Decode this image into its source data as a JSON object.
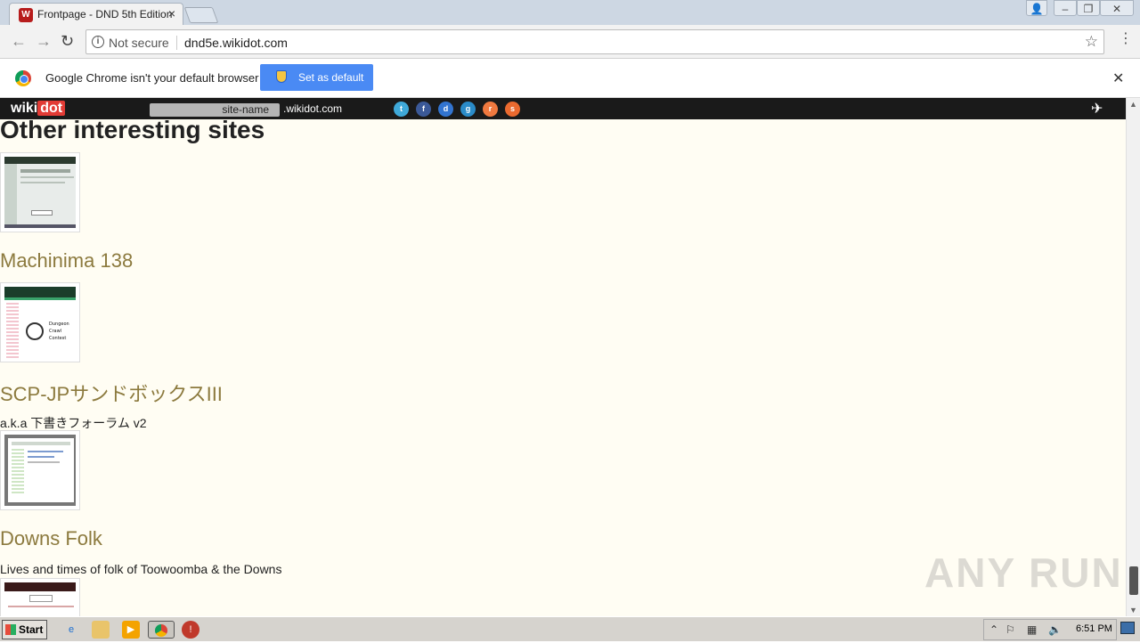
{
  "browser": {
    "tab": {
      "title": "Frontpage - DND 5th Edition",
      "favicon": "wikidot-icon"
    },
    "omnibox": {
      "security_label": "Not secure",
      "url": "dnd5e.wikidot.com"
    },
    "infobar": {
      "message": "Google Chrome isn't your default browser",
      "button_label": "Set as default"
    }
  },
  "wikidot_bar": {
    "logo_left": "wiki",
    "logo_right": "dot",
    "site_name_placeholder": "site-name",
    "domain_suffix": ".wikidot.com",
    "social_icons": [
      "twitter-icon",
      "facebook-icon",
      "delicious-icon",
      "digg-icon",
      "reddit-icon",
      "stumbleupon-icon"
    ]
  },
  "page": {
    "heading": "Other interesting sites",
    "sites": [
      {
        "title": "Machinima 138",
        "description": ""
      },
      {
        "title": "SCP-JPサンドボックスIII",
        "description": "a.k.a 下書きフォーラム v2"
      },
      {
        "title": "Downs Folk",
        "description": "Lives and times of folk of Toowoomba & the Downs"
      }
    ],
    "thumb_dungeon_text": [
      "Dungeon",
      "Crawl",
      "Contest"
    ]
  },
  "watermark": "ANY RUN",
  "taskbar": {
    "start_label": "Start",
    "clock": "6:51 PM"
  },
  "colors": {
    "page_bg": "#fffdf3",
    "site_title": "#8c7a3e",
    "infobar_button": "#4a8af4",
    "wikidot_red": "#e23b35"
  }
}
